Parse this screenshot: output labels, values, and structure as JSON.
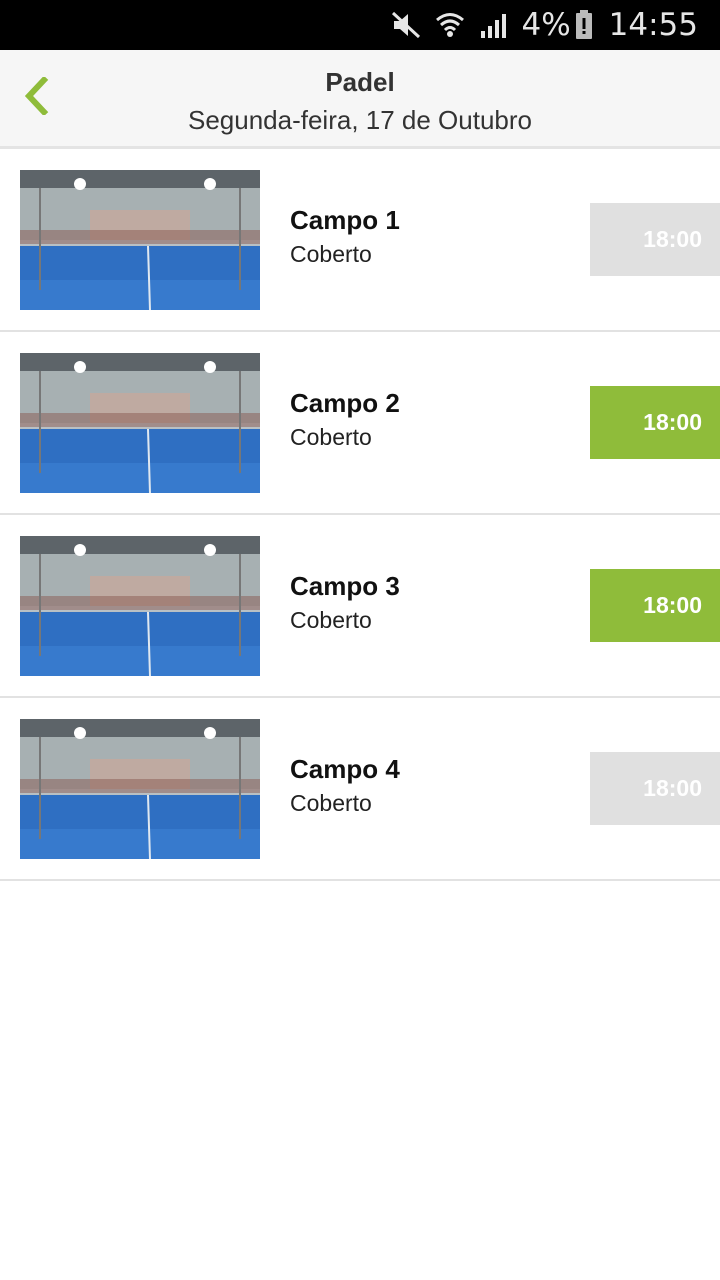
{
  "status_bar": {
    "battery_percent": "4%",
    "time": "14:55"
  },
  "header": {
    "title": "Padel",
    "subtitle": "Segunda-feira, 17 de Outubro",
    "back_icon": "chevron-left-icon"
  },
  "colors": {
    "accent": "#8fbc3a",
    "disabled": "#e0e0e0"
  },
  "courts": [
    {
      "name": "Campo 1",
      "type": "Coberto",
      "time": "18:00",
      "available": false
    },
    {
      "name": "Campo 2",
      "type": "Coberto",
      "time": "18:00",
      "available": true
    },
    {
      "name": "Campo 3",
      "type": "Coberto",
      "time": "18:00",
      "available": true
    },
    {
      "name": "Campo 4",
      "type": "Coberto",
      "time": "18:00",
      "available": false
    }
  ]
}
